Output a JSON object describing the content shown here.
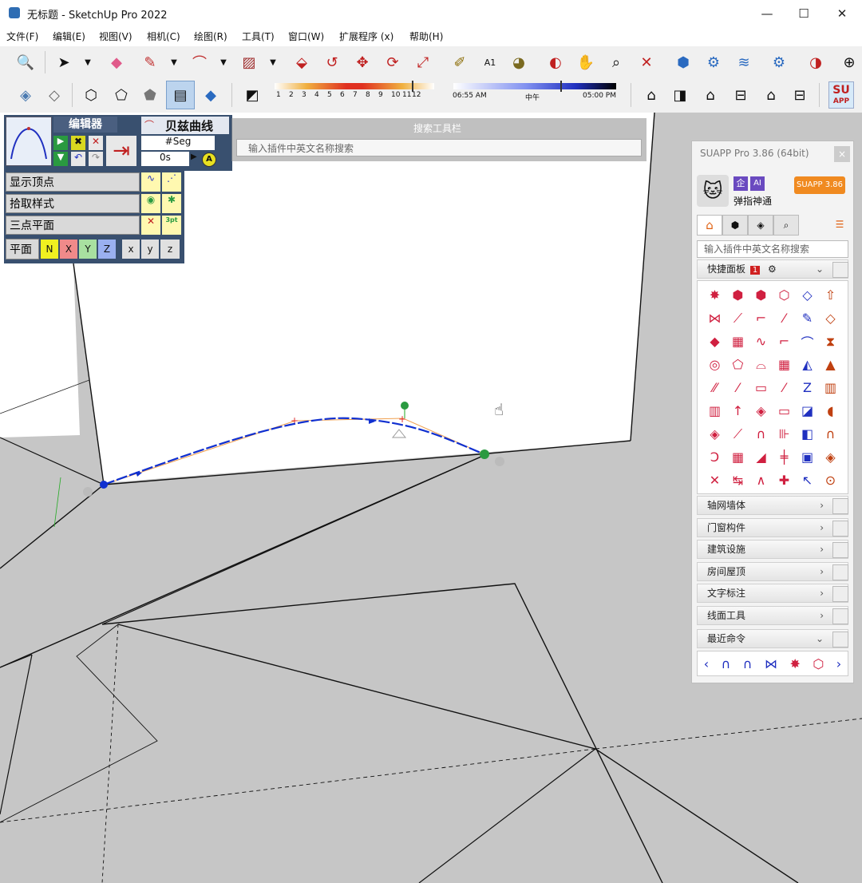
{
  "window": {
    "title": "无标题 - SketchUp Pro 2022",
    "controls": [
      "—",
      "☐",
      "✕"
    ]
  },
  "menu": [
    "文件(F)",
    "编辑(E)",
    "视图(V)",
    "相机(C)",
    "绘图(R)",
    "工具(T)",
    "窗口(W)",
    "扩展程序 (x)",
    "帮助(H)"
  ],
  "shadow_bar": {
    "ticks": [
      "1",
      "2",
      "3",
      "4",
      "5",
      "6",
      "7",
      "8",
      "9",
      "10",
      "11",
      "12"
    ],
    "time_start": "06:55 AM",
    "time_mid": "中午",
    "time_end": "05:00 PM"
  },
  "suapp_button": {
    "line1": "SU",
    "line2": "APP"
  },
  "bezier_editor": {
    "header": "编辑器",
    "curve_name": "贝兹曲线",
    "seg_label": "#Seg",
    "seg_value": "0s",
    "auto_badge": "A",
    "rows": [
      {
        "label": "显示顶点"
      },
      {
        "label": "拾取样式"
      },
      {
        "label": "三点平面",
        "badge": "3pt"
      }
    ],
    "plane_label": "平面",
    "plane_buttons": [
      "N",
      "X",
      "Y",
      "Z",
      "x",
      "y",
      "z"
    ]
  },
  "search_toolbar": {
    "title": "搜索工具栏",
    "placeholder": "输入插件中英文名称搜索"
  },
  "suapp_panel": {
    "title": "SUAPP Pro 3.86 (64bit)",
    "close": "×",
    "badge_qi": "企",
    "badge_ai": "AI",
    "version_button": "SUAPP 3.86",
    "user": "弹指神通",
    "tabs": [
      "home-icon",
      "box-icon",
      "structure-icon",
      "search-icon"
    ],
    "search_placeholder": "输入插件中英文名称搜索",
    "quick_panel": "快捷面板",
    "quick_panel_badge": "1",
    "sections": [
      "轴网墙体",
      "门窗构件",
      "建筑设施",
      "房间屋顶",
      "文字标注",
      "线面工具",
      "最近命令"
    ],
    "icons": [
      "✸",
      "⬢",
      "⬢",
      "⬡",
      "◇",
      "⇧",
      "⋈",
      "⟋",
      "⌐",
      "⁄",
      "✎",
      "◇",
      "◆",
      "▦",
      "∿",
      "⌐",
      "⌒",
      "⧗",
      "◎",
      "⬠",
      "⌓",
      "▦",
      "◭",
      "▲",
      "⁄⁄",
      "⁄",
      "▭",
      "⁄",
      "Z",
      "▥",
      "▥",
      "↑",
      "◈",
      "▭",
      "◪",
      "◖",
      "◈",
      "⟋",
      "∩",
      "⊪",
      "◧",
      "∩",
      "Ↄ",
      "▦",
      "◢",
      "╪",
      "▣",
      "◈",
      "✕",
      "↹",
      "∧",
      "✚",
      "↖",
      "⊙"
    ],
    "recent_icons": [
      "‹",
      "∩",
      "∩",
      "⋈",
      "✸",
      "⬡",
      "›"
    ]
  }
}
